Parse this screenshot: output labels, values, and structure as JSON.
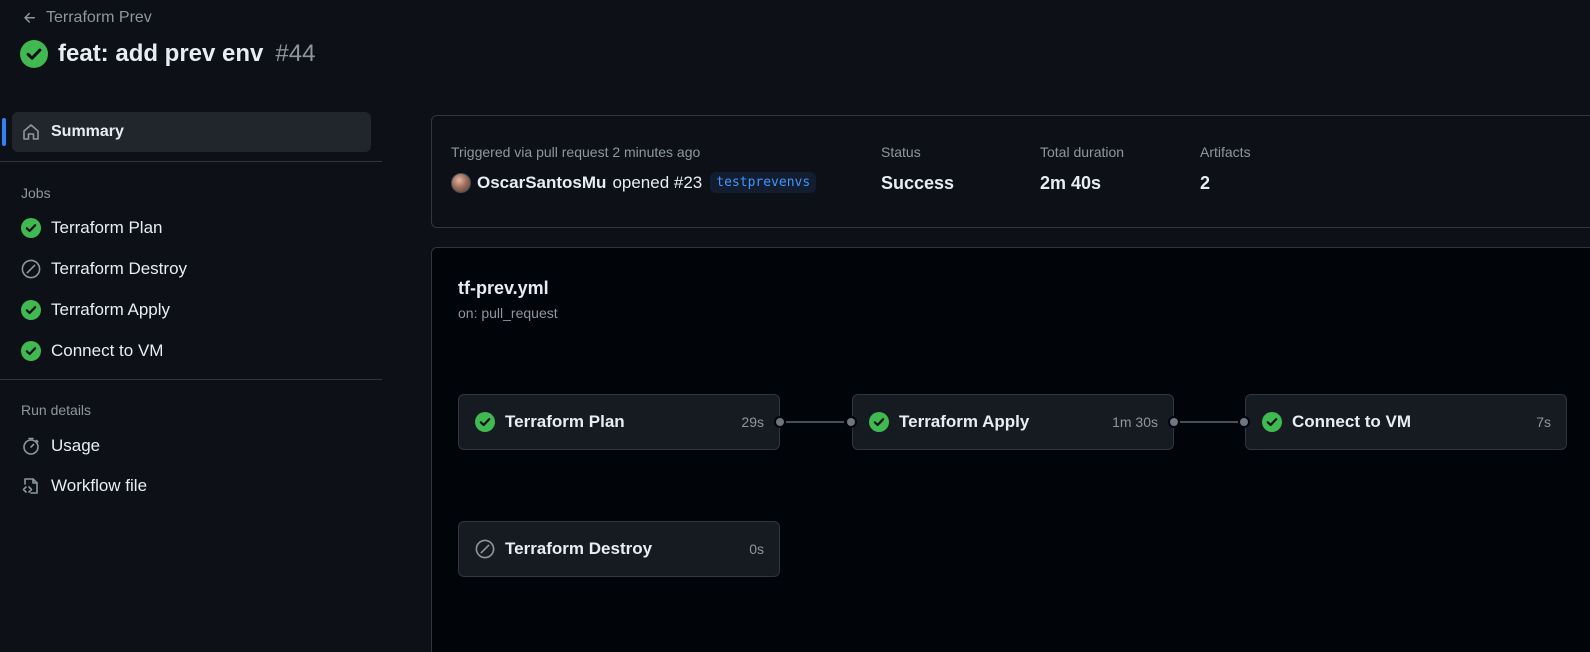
{
  "header": {
    "back_label": "Terraform Prev",
    "title": "feat: add prev env",
    "run_number": "#44"
  },
  "sidebar": {
    "summary_label": "Summary",
    "jobs_heading": "Jobs",
    "jobs": [
      {
        "label": "Terraform Plan",
        "status": "success"
      },
      {
        "label": "Terraform Destroy",
        "status": "skipped"
      },
      {
        "label": "Terraform Apply",
        "status": "success"
      },
      {
        "label": "Connect to VM",
        "status": "success"
      }
    ],
    "run_details_heading": "Run details",
    "usage_label": "Usage",
    "workflow_file_label": "Workflow file"
  },
  "summary": {
    "trigger_text": "Triggered via pull request 2 minutes ago",
    "author": "OscarSantosMu",
    "action": "opened #23",
    "branch": "testprevenvs",
    "status_label": "Status",
    "status_value": "Success",
    "duration_label": "Total duration",
    "duration_value": "2m 40s",
    "artifacts_label": "Artifacts",
    "artifacts_value": "2"
  },
  "workflow": {
    "file_name": "tf-prev.yml",
    "trigger": "on: pull_request",
    "jobs": [
      {
        "name": "Terraform Plan",
        "duration": "29s",
        "status": "success"
      },
      {
        "name": "Terraform Apply",
        "duration": "1m 30s",
        "status": "success"
      },
      {
        "name": "Connect to VM",
        "duration": "7s",
        "status": "success"
      },
      {
        "name": "Terraform Destroy",
        "duration": "0s",
        "status": "skipped"
      }
    ]
  },
  "colors": {
    "background": "#0d1117",
    "success": "#3fb950",
    "accent": "#2f81f7",
    "muted": "#8d96a0"
  }
}
